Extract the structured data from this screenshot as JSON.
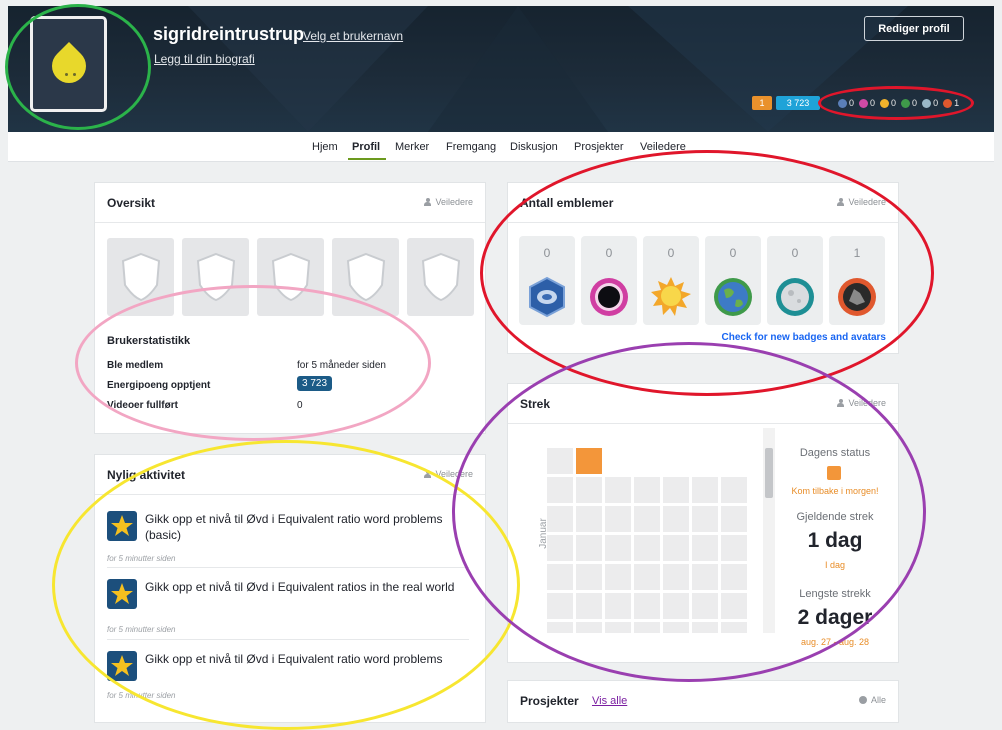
{
  "header": {
    "username": "sigridreintrustrup",
    "choose_username_link": "Velg et brukernavn",
    "add_bio_link": "Legg til din biografi",
    "edit_profile_button": "Rediger profil",
    "level_pill": "1",
    "points_pill": "3 723",
    "badge_counts": [
      {
        "icon": "meteorite-badge-icon",
        "count": "0",
        "color": "#5a7fb8"
      },
      {
        "icon": "moon-badge-icon",
        "count": "0",
        "color": "#d04aa6"
      },
      {
        "icon": "earth-badge-icon",
        "count": "0",
        "color": "#f2b32c"
      },
      {
        "icon": "sun-badge-icon",
        "count": "0",
        "color": "#3f9a4a"
      },
      {
        "icon": "black-hole-badge-icon",
        "count": "0",
        "color": "#9ab8c8"
      },
      {
        "icon": "challenge-patch-icon",
        "count": "1",
        "color": "#e0582e"
      }
    ]
  },
  "nav": {
    "items": [
      "Hjem",
      "Profil",
      "Merker",
      "Fremgang",
      "Diskusjon",
      "Prosjekter",
      "Veiledere"
    ],
    "active_index": 1
  },
  "overview": {
    "title": "Oversikt",
    "guide": "Veiledere",
    "stats_title": "Brukerstatistikk",
    "stats": [
      {
        "label": "Ble medlem",
        "value": "for 5 måneder siden"
      },
      {
        "label": "Energipoeng opptjent",
        "value": "3 723"
      },
      {
        "label": "Videoer fullført",
        "value": "0"
      }
    ]
  },
  "recent": {
    "title": "Nylig aktivitet",
    "guide": "Veiledere",
    "items": [
      {
        "text": "Gikk opp et nivå til Øvd i Equivalent ratio word problems (basic)",
        "time": "for 5 minutter siden"
      },
      {
        "text": "Gikk opp et nivå til Øvd i Equivalent ratios in the real world",
        "time": "for 5 minutter siden"
      },
      {
        "text": "Gikk opp et nivå til Øvd i Equivalent ratio word problems",
        "time": "for 5 minutter siden"
      }
    ]
  },
  "badges": {
    "title": "Antall emblemer",
    "guide": "Veiledere",
    "counts": [
      "0",
      "0",
      "0",
      "0",
      "0",
      "1"
    ],
    "check_link": "Check for new badges and avatars"
  },
  "streak": {
    "title": "Strek",
    "guide": "Veiledere",
    "month_label": "Januar",
    "today_status_label": "Dagens status",
    "come_back": "Kom tilbake i morgen!",
    "current_label": "Gjeldende strek",
    "current_value": "1 dag",
    "current_sub": "I dag",
    "longest_label": "Lengste strekk",
    "longest_value": "2 dager",
    "longest_sub": "aug. 27 - aug. 28",
    "active_color": "#f3963a"
  },
  "projects": {
    "title": "Prosjekter",
    "see_all": "Vis alle",
    "filter": "Alle"
  }
}
